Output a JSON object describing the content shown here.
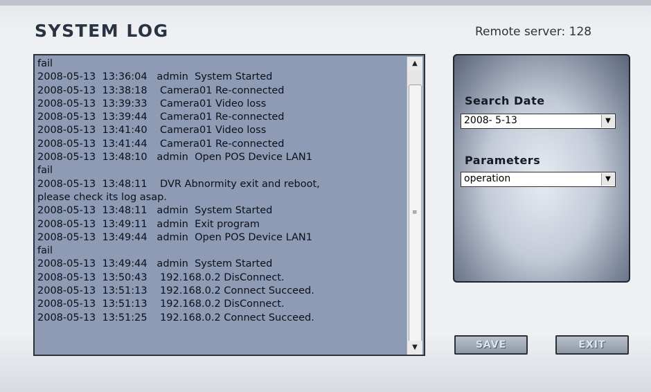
{
  "header": {
    "title": "SYSTEM LOG",
    "remote_server": "Remote server: 128"
  },
  "log": {
    "lines": [
      "fail",
      "2008-05-13  13:36:04   admin  System Started",
      "2008-05-13  13:38:18    Camera01 Re-connected",
      "2008-05-13  13:39:33    Camera01 Video loss",
      "2008-05-13  13:39:44    Camera01 Re-connected",
      "2008-05-13  13:41:40    Camera01 Video loss",
      "2008-05-13  13:41:44    Camera01 Re-connected",
      "2008-05-13  13:48:10   admin  Open POS Device LAN1",
      "fail",
      "2008-05-13  13:48:11    DVR Abnormity exit and reboot,",
      "please check its log asap.",
      "2008-05-13  13:48:11   admin  System Started",
      "2008-05-13  13:49:11   admin  Exit program",
      "2008-05-13  13:49:44   admin  Open POS Device LAN1",
      "fail",
      "2008-05-13  13:49:44   admin  System Started",
      "2008-05-13  13:50:43    192.168.0.2 DisConnect.",
      "2008-05-13  13:51:13    192.168.0.2 Connect Succeed.",
      "2008-05-13  13:51:13    192.168.0.2 DisConnect.",
      "2008-05-13  13:51:25    192.168.0.2 Connect Succeed."
    ],
    "scroll_up_glyph": "▲",
    "scroll_down_glyph": "▼",
    "thumb_grip_glyph": "≡"
  },
  "panel": {
    "search_date_label": "Search Date",
    "search_date_value": "2008- 5-13",
    "parameters_label": "Parameters",
    "parameters_value": "operation",
    "dropdown_glyph": "▼"
  },
  "buttons": {
    "save": "SAVE",
    "exit": "EXIT"
  },
  "colors": {
    "log_background": "#8d9bb5",
    "window_background": "#eef0f3"
  }
}
